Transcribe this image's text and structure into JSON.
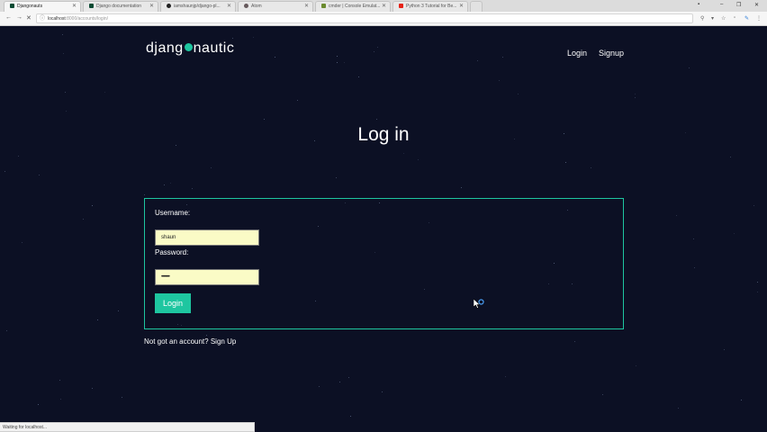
{
  "browser": {
    "tabs": [
      {
        "label": "Djangonauts",
        "active": true,
        "favicon_color": "#0c4b33"
      },
      {
        "label": "Django documentation",
        "active": false,
        "favicon_color": "#0c4b33"
      },
      {
        "label": "iamshaunjp/django-pl...",
        "active": false,
        "favicon_color": "#222222"
      },
      {
        "label": "Atom",
        "active": false,
        "favicon_color": "#66595c"
      },
      {
        "label": "cmder | Console Emulat...",
        "active": false,
        "favicon_color": "#6a8a2e"
      },
      {
        "label": "Python 3 Tutorial for Be...",
        "active": false,
        "favicon_color": "#e62117"
      }
    ],
    "url_host": "localhost",
    "url_rest": ":8000/accounts/login/",
    "status_text": "Waiting for localhost..."
  },
  "site": {
    "logo_left": "djang",
    "logo_right": "nautic",
    "nav": {
      "login": "Login",
      "signup": "Signup"
    },
    "title": "Log in"
  },
  "form": {
    "username_label": "Username:",
    "username_value": "shaun",
    "password_label": "Password:",
    "password_value": "••••••••",
    "submit_label": "Login"
  },
  "footer": {
    "prompt": "Not got an account?",
    "link": "Sign Up"
  },
  "colors": {
    "background": "#0c1024",
    "accent": "#1ec6a0",
    "input_bg": "#fafbc6"
  }
}
